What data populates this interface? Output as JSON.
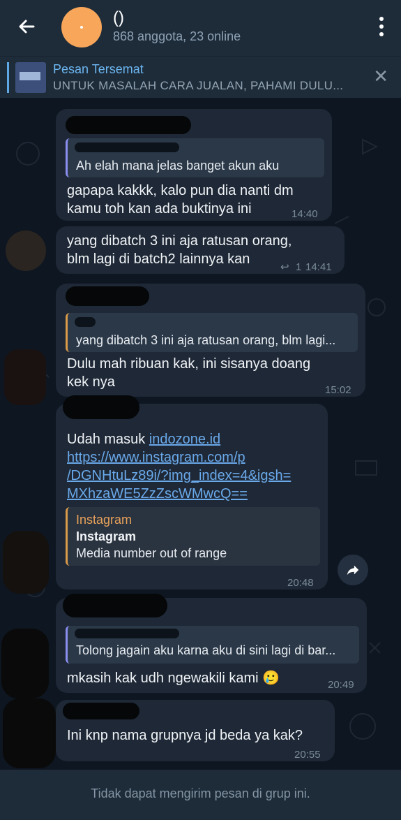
{
  "header": {
    "title": "()",
    "subtitle": "868 anggota, 23 online"
  },
  "pinned": {
    "title": "Pesan Tersemat",
    "text": "UNTUK MASALAH CARA JUALAN, PAHAMI DULU..."
  },
  "messages": [
    {
      "reply_text": "Ah elah mana jelas banget akun aku",
      "lines": [
        "gapapa kakkk, kalo pun dia nanti dm",
        "kamu toh kan ada buktinya ini"
      ],
      "time": "14:40"
    },
    {
      "lines": [
        "yang dibatch 3 ini aja ratusan orang,",
        "blm lagi di batch2 lainnya kan"
      ],
      "reply_count": "1",
      "time": "14:41"
    },
    {
      "reply_text": "yang dibatch 3 ini aja ratusan orang, blm lagi...",
      "lines": [
        "Dulu mah ribuan kak, ini sisanya doang",
        "kek nya"
      ],
      "time": "15:02"
    },
    {
      "prefix": "Udah masuk ",
      "link1": "indozone.id",
      "link_lines": [
        "https://www.instagram.com/p",
        "/DGNHtuLz89i/?img_index=4&igsh=",
        "MXhzaWE5ZzZscWMwcQ=="
      ],
      "preview_site": "Instagram",
      "preview_title": "Instagram",
      "preview_desc": "Media number out of range",
      "time": "20:48"
    },
    {
      "reply_text": "Tolong jagain aku karna aku di sini lagi di bar...",
      "lines": [
        "mkasih kak udh ngewakili kami 🥲"
      ],
      "time": "20:49"
    },
    {
      "lines": [
        "Ini knp nama grupnya jd beda ya kak?"
      ],
      "time": "20:55"
    }
  ],
  "footer": {
    "text": "Tidak dapat mengirim pesan di grup ini."
  },
  "icons": [
    "back-arrow-icon",
    "more-vert-icon",
    "close-icon",
    "share-icon",
    "reply-arrow-icon"
  ],
  "colors": {
    "header_bg": "#1e2c3a",
    "bubble_bg": "#1e2836",
    "accent": "#6cb6f0",
    "avatar": "#f7a65a"
  }
}
